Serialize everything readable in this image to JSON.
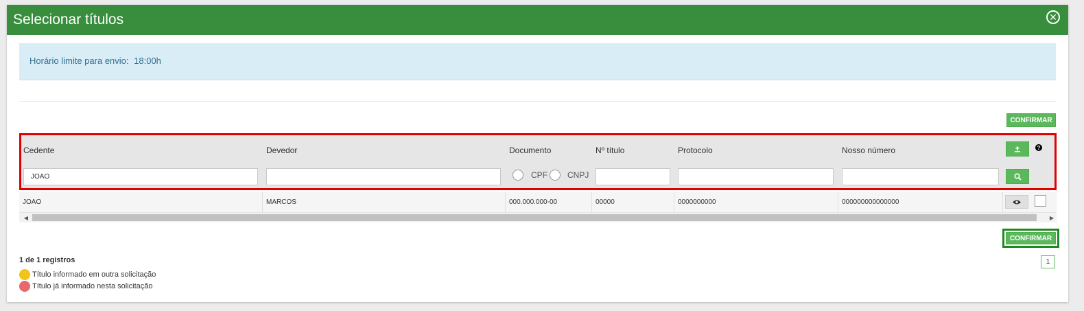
{
  "modal": {
    "title": "Selecionar títulos",
    "close_icon": "close-circle-icon"
  },
  "info": {
    "label": "Horário limite para envio:",
    "value": "18:00h"
  },
  "buttons": {
    "confirm_top": "CONFIRMAR",
    "confirm_bottom": "CONFIRMAR"
  },
  "filters": {
    "columns": [
      "Cedente",
      "Devedor",
      "Documento",
      "Nº título",
      "Protocolo",
      "Nosso número"
    ],
    "cedente_value": "JOAO",
    "devedor_value": "",
    "numero_titulo_value": "",
    "protocolo_value": "",
    "nosso_numero_value": "",
    "document_options": [
      "CPF",
      "CNPJ"
    ],
    "upload_icon": "upload-icon",
    "search_icon": "search-icon",
    "help_icon": "question-icon"
  },
  "rows": [
    {
      "cedente": "JOAO",
      "devedor": "MARCOS",
      "documento": "000.000.000-00",
      "numero_titulo": "00000",
      "protocolo": "0000000000",
      "nosso_numero": "000000000000000",
      "view_icon": "eye-icon"
    }
  ],
  "footer": {
    "records": "1 de 1 registros",
    "legend": [
      {
        "label": "Título informado em outra solicitação",
        "color": "#f0c419"
      },
      {
        "label": "Título já informado nesta solicitação",
        "color": "#e8696b"
      }
    ],
    "page": "1"
  },
  "colors": {
    "header_green": "#388e3c",
    "button_green": "#5cb85c",
    "info_bg": "#d9edf7",
    "highlight_red": "#e00000"
  }
}
